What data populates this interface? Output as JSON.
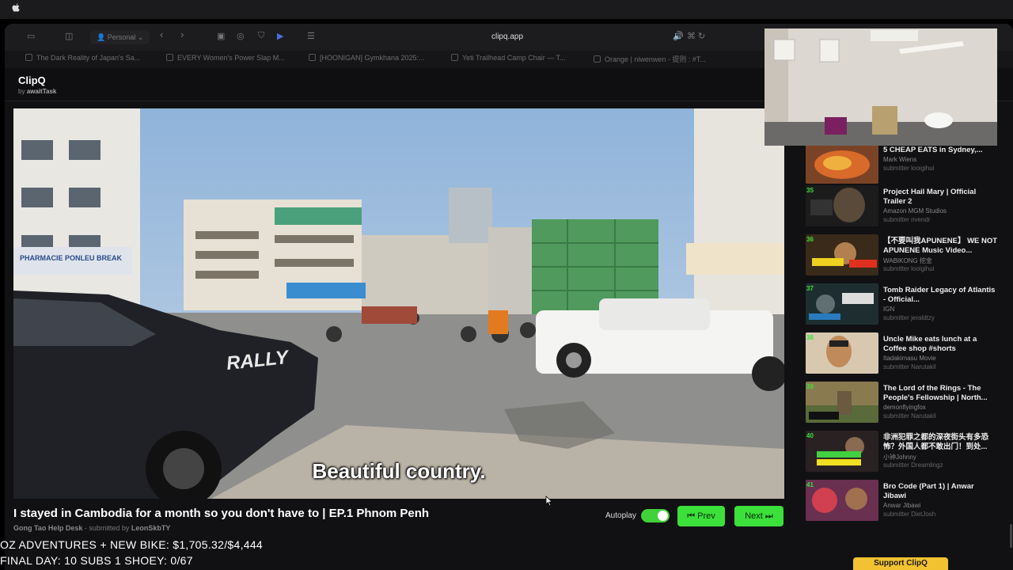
{
  "browser": {
    "profile_label": "Personal",
    "url": "clipq.app",
    "tabs": [
      {
        "label": "The Dark Reality of Japan's Sa..."
      },
      {
        "label": "EVERY Women's Power Slap M..."
      },
      {
        "label": "[HOONIGAN] Gymkhana 2025:..."
      },
      {
        "label": "Yeti Trailhead Camp Chair — T..."
      },
      {
        "label": "Orange | niwenwen - 提则 : #T..."
      }
    ]
  },
  "app": {
    "brand": "ClipQ",
    "by_prefix": "by",
    "by_name": "awaitTask"
  },
  "video": {
    "subtitle": "Beautiful country.",
    "title": "I stayed in Cambodia for a month so you don't have to | EP.1 Phnom Penh",
    "channel": "Gong Tao Help Desk",
    "submitted_by_prefix": "- submitted by",
    "submitted_by": "LeonSkbTY",
    "signs": {
      "pharmacie": "PHARMACIE PONLEU BREAK",
      "rally": "RALLY"
    }
  },
  "controls": {
    "autoplay_label": "Autoplay",
    "autoplay_on": true,
    "prev_label": "⏮ Prev",
    "next_label": "Next ⏭"
  },
  "queue": [
    {
      "num": "",
      "title": "5 CHEAP EATS in Sydney,...",
      "channel": "Mark Wiens",
      "submitter": "submitter looigihui",
      "thumb_color": "#8a4a2a"
    },
    {
      "num": "35",
      "title": "Project Hail Mary | Official Trailer 2",
      "channel": "Amazon MGM Studios",
      "submitter": "submitter nvendr",
      "thumb_color": "#2a2a2a"
    },
    {
      "num": "36",
      "title": "【不要叫我APUNENE】 WE NOT APUNENE Music Video...",
      "channel": "WABIKONG 挖金",
      "submitter": "submitter looigihui",
      "thumb_color": "#7a5a30"
    },
    {
      "num": "37",
      "title": "Tomb Raider Legacy of Atlantis - Official...",
      "channel": "IGN",
      "submitter": "submitter jeraldtzy",
      "thumb_color": "#2a3a3a"
    },
    {
      "num": "38",
      "title": "Uncle Mike eats lunch at a Coffee shop #shorts",
      "channel": "Itadakimasu Movie",
      "submitter": "submitter Narutakil",
      "thumb_color": "#c08a5a"
    },
    {
      "num": "39",
      "title": "The Lord of the Rings - The People's Fellowship | North...",
      "channel": "demonflyingfox",
      "submitter": "submitter Narutakil",
      "thumb_color": "#6a6040"
    },
    {
      "num": "40",
      "title": "非洲犯罪之都的深夜街头有多恐怖？外国人都不敢出门！到处...",
      "channel": "小钟Johnny",
      "submitter": "submitter Dreamlingz",
      "thumb_color": "#3a3030"
    },
    {
      "num": "41",
      "title": "Bro Code (Part 1) | Anwar Jibawi",
      "channel": "Anwar Jibawi",
      "submitter": "submitter DietJosh",
      "thumb_color": "#8a3050"
    }
  ],
  "overlay": {
    "line1": "OZ ADVENTURES + NEW BIKE: $1,705.32/$4,444",
    "line2": "FINAL DAY: 10 SUBS 1 SHOEY: 0/67"
  },
  "support_label": "Support ClipQ",
  "colors": {
    "accent": "#3be03a",
    "support": "#f2c230"
  }
}
